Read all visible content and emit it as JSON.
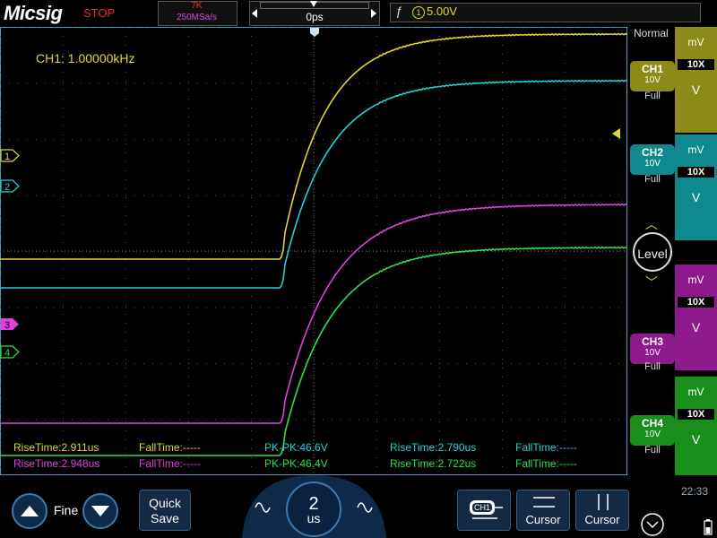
{
  "header": {
    "brand": "Micsig",
    "run_state": "STOP",
    "memory_depth": "7K",
    "sample_rate": "250MSa/s",
    "horizontal_offset": "0ps",
    "trigger": {
      "source_label": "1",
      "level": "5.00V"
    }
  },
  "plot": {
    "frequency_readout": "CH1: 1.00000kHz",
    "channel_markers": [
      "1",
      "2",
      "3",
      "4"
    ],
    "measurements": {
      "row1": [
        {
          "text": "RiseTime:2.911us",
          "color": "#ddd832"
        },
        {
          "text": "FallTime:-----",
          "color": "#ddd832"
        },
        {
          "text": "PK-PK:46.6V",
          "color": "#22d0d8"
        },
        {
          "text": "RiseTime:2.790us",
          "color": "#22d0d8"
        },
        {
          "text": "FallTime:-----",
          "color": "#22d0d8"
        }
      ],
      "row2": [
        {
          "text": "RiseTime:2.948us",
          "color": "#e040e0"
        },
        {
          "text": "FallTime:-----",
          "color": "#e040e0"
        },
        {
          "text": "PK-PK:46.4V",
          "color": "#2ee048"
        },
        {
          "text": "RiseTime:2.722us",
          "color": "#2ee048"
        },
        {
          "text": "FallTime:-----",
          "color": "#2ee048"
        }
      ]
    }
  },
  "right_panel": {
    "acquisition_mode": "Normal",
    "channels": [
      {
        "name": "CH1",
        "scale": "10V",
        "bandwidth": "Full",
        "color": "#8c8a18"
      },
      {
        "name": "CH2",
        "scale": "10V",
        "bandwidth": "Full",
        "color": "#0e8a8e"
      },
      {
        "name": "CH3",
        "scale": "10V",
        "bandwidth": "Full",
        "color": "#8e1a8e"
      },
      {
        "name": "CH4",
        "scale": "10V",
        "bandwidth": "Full",
        "color": "#1a8e1a"
      }
    ],
    "probe_buttons": [
      {
        "up": "mV",
        "ratio": "10X",
        "down": "V",
        "color": "#8c8a18"
      },
      {
        "up": "mV",
        "ratio": "10X",
        "down": "V",
        "color": "#0e8a8e"
      },
      {
        "up": "mV",
        "ratio": "10X",
        "down": "V",
        "color": "#8e1a8e"
      },
      {
        "up": "mV",
        "ratio": "10X",
        "down": "V",
        "color": "#1a8e1a"
      }
    ],
    "level_label": "Level"
  },
  "bottom": {
    "fine_label": "Fine",
    "quick_save_line1": "Quick",
    "quick_save_line2": "Save",
    "timebase_value": "2",
    "timebase_unit": "us",
    "ch1_button_label": "CH1",
    "cursor1_label": "Cursor",
    "cursor2_label": "Cursor",
    "clock": "22:33"
  },
  "colors": {
    "ch1": "#ddd832",
    "ch2": "#22d0d8",
    "ch3": "#e040e0",
    "ch4": "#2ee048",
    "grid": "#555555",
    "frame": "#4aa0b8"
  },
  "icons": [
    "up-arrow-icon",
    "down-arrow-icon",
    "wave-left-icon",
    "wave-right-icon",
    "ch1-probe-icon",
    "cursor-horizontal-icon",
    "cursor-vertical-icon",
    "chevron-down-circle-icon",
    "battery-icon",
    "rising-edge-icon"
  ]
}
